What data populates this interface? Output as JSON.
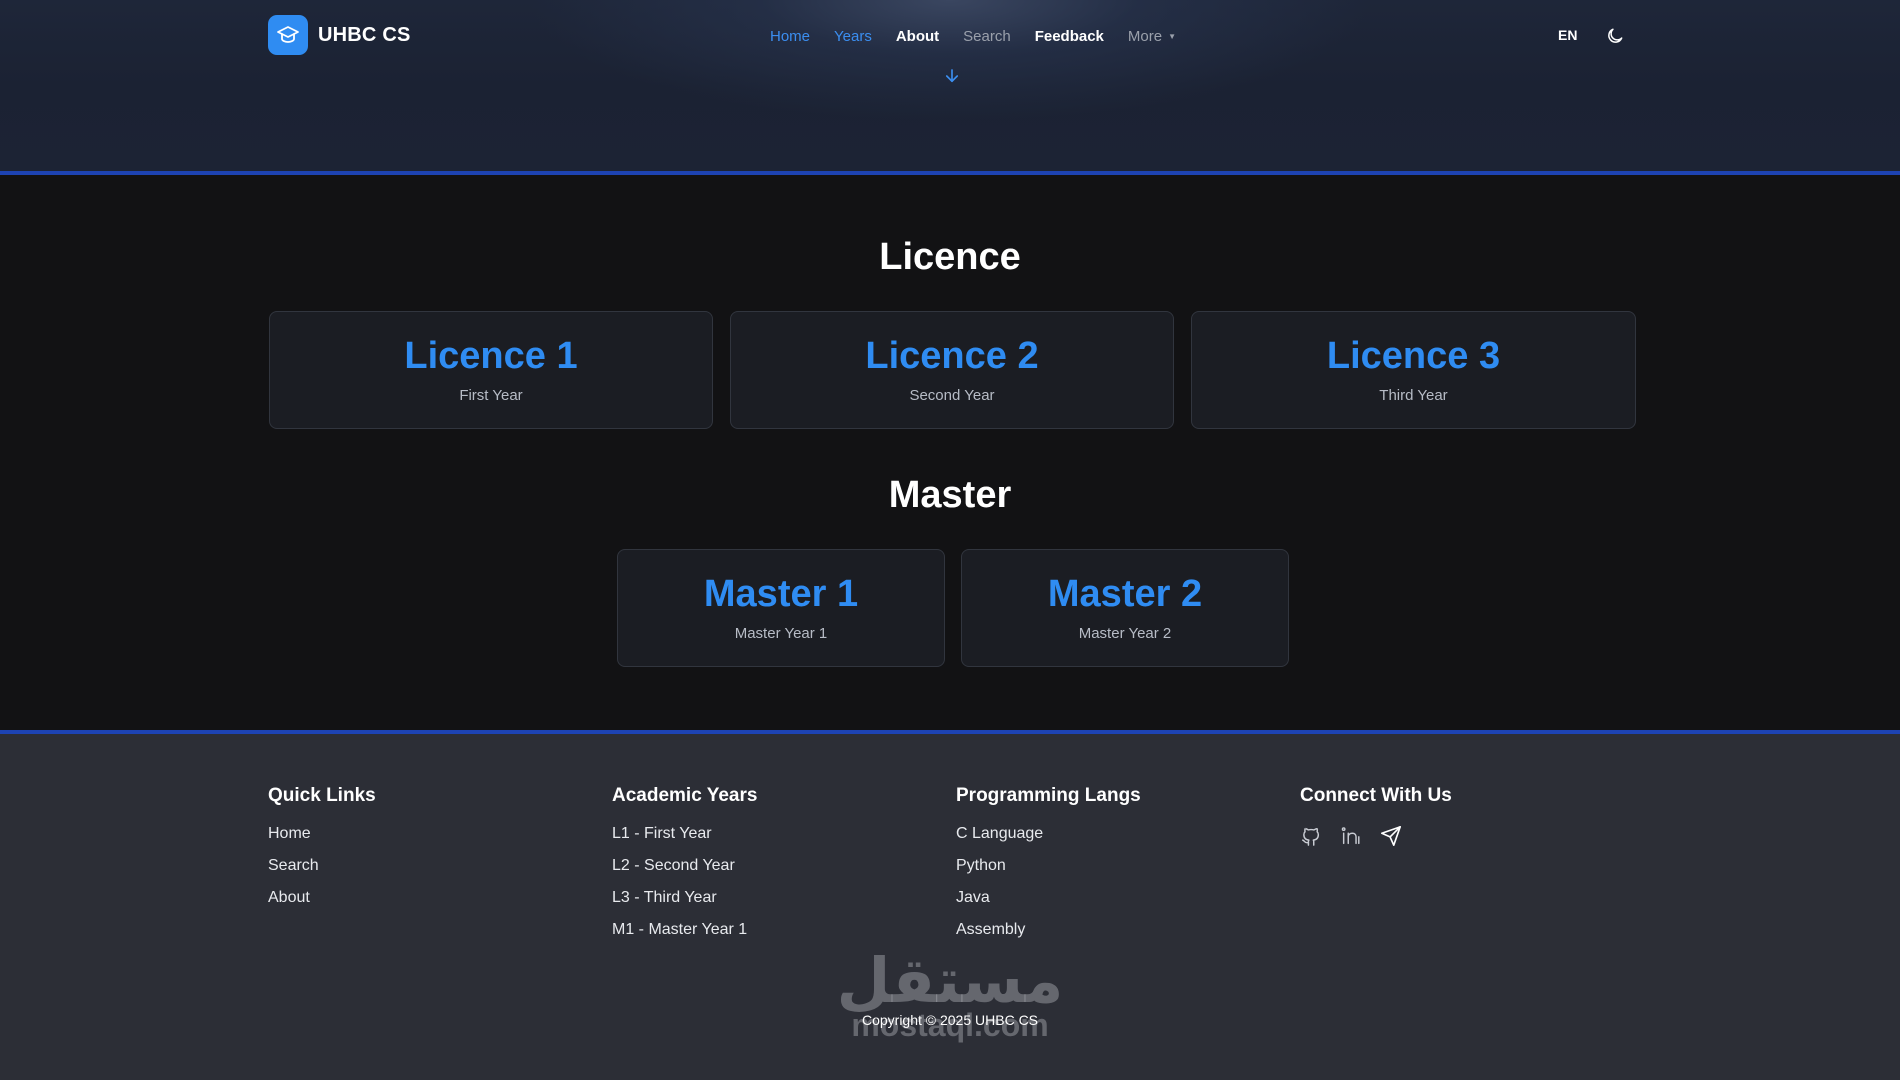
{
  "header": {
    "brand": "UHBC CS",
    "nav": [
      {
        "label": "Home"
      },
      {
        "label": "Years"
      },
      {
        "label": "About"
      },
      {
        "label": "Search"
      },
      {
        "label": "Feedback"
      },
      {
        "label": "More"
      }
    ],
    "language": "EN",
    "icons": {
      "logo": "graduation-cap-icon",
      "theme": "moon-icon",
      "scroll": "arrow-down-icon"
    }
  },
  "licence": {
    "title": "Licence",
    "cards": [
      {
        "title": "Licence 1",
        "subtitle": "First Year"
      },
      {
        "title": "Licence 2",
        "subtitle": "Second Year"
      },
      {
        "title": "Licence 3",
        "subtitle": "Third Year"
      }
    ]
  },
  "master": {
    "title": "Master",
    "cards": [
      {
        "title": "Master 1",
        "subtitle": "Master Year 1"
      },
      {
        "title": "Master 2",
        "subtitle": "Master Year 2"
      }
    ]
  },
  "footer": {
    "quick_links": {
      "title": "Quick Links",
      "items": [
        "Home",
        "Search",
        "About"
      ]
    },
    "academic_years": {
      "title": "Academic Years",
      "items": [
        "L1 - First Year",
        "L2 - Second Year",
        "L3 - Third Year",
        "M1 - Master Year 1"
      ]
    },
    "programming": {
      "title": "Programming Langs",
      "items": [
        "C Language",
        "Python",
        "Java",
        "Assembly"
      ]
    },
    "connect": {
      "title": "Connect With Us",
      "icons": [
        "github-icon",
        "linkedin-icon",
        "telegram-icon"
      ]
    },
    "copyright": "Copyright © 2025 UHBC CS",
    "watermark": {
      "arabic": "مستقل",
      "latin": "mostaql.com"
    }
  },
  "colors": {
    "accent": "#2f8cf2",
    "divider": "#1d43b3",
    "footer_bg": "#2c2e36"
  }
}
